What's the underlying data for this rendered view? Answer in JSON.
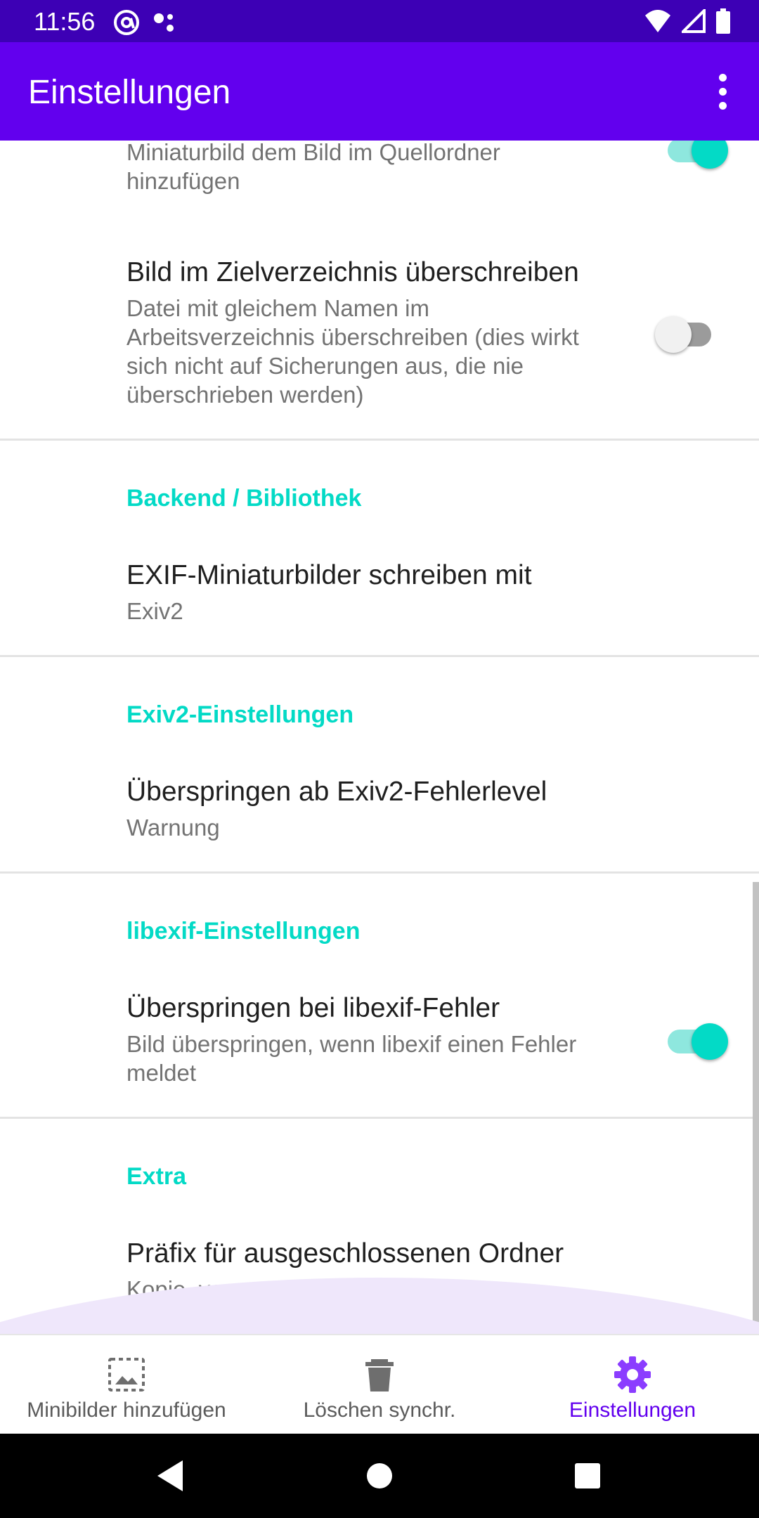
{
  "status_bar": {
    "time": "11:56",
    "left_icons": [
      "at-sign-icon",
      "dots-icon"
    ],
    "right_icons": [
      "wifi-icon",
      "signal-icon",
      "battery-icon"
    ]
  },
  "app_bar": {
    "title": "Einstellungen",
    "menu_icon": "more-vert-icon"
  },
  "preferences": {
    "thumb_in_source": {
      "summary": "Miniaturbild dem Bild im Quellordner hinzufügen",
      "enabled": true
    },
    "overwrite_dest": {
      "title": "Bild im Zielverzeichnis überschreiben",
      "summary": "Datei mit gleichem Namen im Arbeitsverzeichnis überschreiben (dies wirkt sich nicht auf Sicherungen aus, die nie überschrieben werden)",
      "enabled": false
    },
    "backend_section": {
      "header": "Backend / Bibliothek",
      "title": "EXIF-Miniaturbilder schreiben mit",
      "value": "Exiv2"
    },
    "exiv2_section": {
      "header": "Exiv2-Einstellungen",
      "title": "Überspringen ab Exiv2-Fehlerlevel",
      "value": "Warnung"
    },
    "libexif_section": {
      "header": "libexif-Einstellungen",
      "title": "Überspringen bei libexif-Fehler",
      "summary": "Bild überspringen, wenn libexif einen Fehler meldet",
      "enabled": true
    },
    "extra_section": {
      "header": "Extra",
      "title": "Präfix für ausgeschlossenen Ordner",
      "value": "Kopie_von_"
    }
  },
  "bottom_nav": {
    "items": [
      {
        "label": "Minibilder hinzufügen",
        "icon": "add-thumbnail-icon",
        "active": false
      },
      {
        "label": "Löschen synchr.",
        "icon": "trash-icon",
        "active": false
      },
      {
        "label": "Einstellungen",
        "icon": "gear-icon",
        "active": true
      }
    ]
  },
  "colors": {
    "status_bar": "#3d00b5",
    "app_bar": "#6200ee",
    "section_header": "#03dac6",
    "active_nav": "#6200ee"
  }
}
